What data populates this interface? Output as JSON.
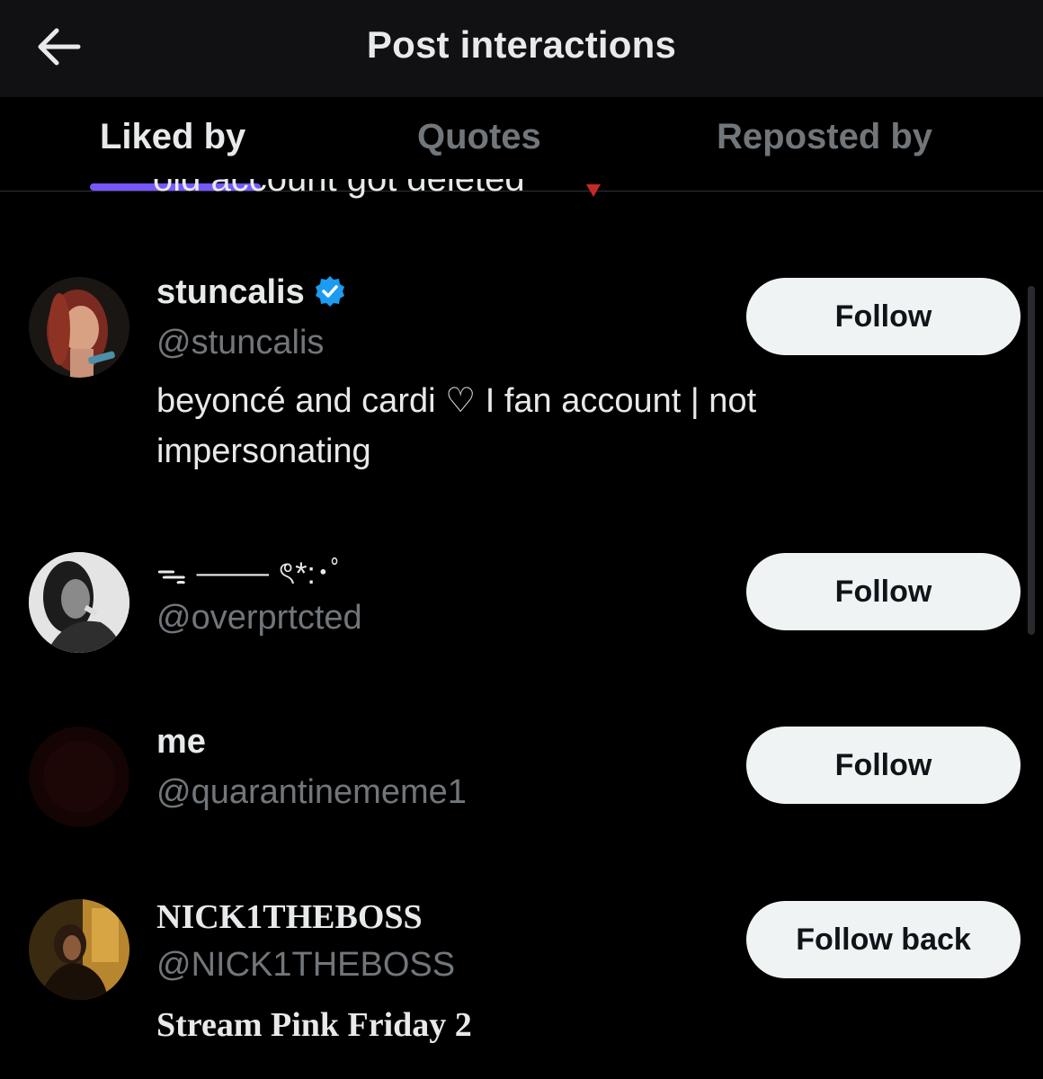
{
  "header": {
    "title": "Post interactions",
    "back_icon": "arrow-left-icon"
  },
  "tabs": [
    {
      "label": "Liked by",
      "active": true
    },
    {
      "label": "Quotes",
      "active": false
    },
    {
      "label": "Reposted by",
      "active": false
    }
  ],
  "accent_color": "#7856ff",
  "peek": {
    "text": "old account got deleted"
  },
  "users": [
    {
      "display_name": "stuncalis",
      "verified": true,
      "handle": "@stuncalis",
      "bio_line1": "beyoncé and cardi ♡ I fan account | not",
      "bio_line2": "impersonating",
      "button": "Follow"
    },
    {
      "display_name": "ᯓ ⸻ ৎ*:･ﾟ",
      "verified": false,
      "handle": "@overprtcted",
      "button": "Follow"
    },
    {
      "display_name": "me",
      "verified": false,
      "handle": "@quarantinememe1",
      "button": "Follow"
    },
    {
      "display_name": "NICK1THEBOSS",
      "verified": false,
      "handle": "@NICK1THEBOSS",
      "bio_line1": "Stream Pink Friday 2",
      "button": "Follow back"
    }
  ],
  "colors": {
    "background": "#000000",
    "header_bg": "#111113",
    "primary_text": "#e7e9ea",
    "secondary_text": "#71767b",
    "button_bg": "#eff3f4",
    "verified_blue": "#1d9bf0"
  }
}
